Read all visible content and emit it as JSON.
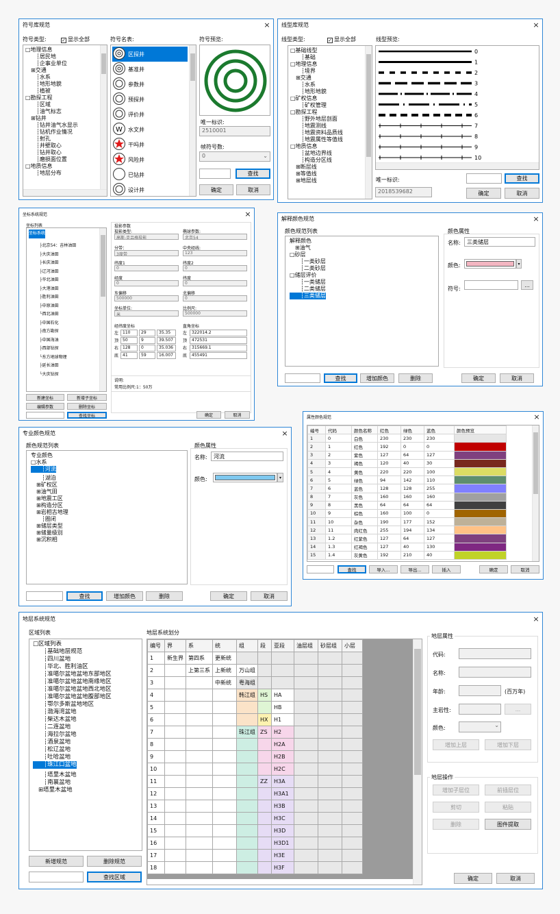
{
  "dlg1": {
    "title": "符号库规范",
    "close": "×",
    "type_label": "符号类型:",
    "show_all": "显示全部",
    "name_label": "符号名表:",
    "preview_label": "符号预览:",
    "tree": [
      "□地理信息",
      "┆居民地",
      "┆企事业单位",
      "⊞交通",
      "┆水系",
      "┆地形地貌",
      "┆植被",
      "□勘探工程",
      "┆区域",
      "┆油气标志",
      "⊞钻井",
      "┆钻井油气水显示",
      "┆钻机作业情况",
      "┆射孔",
      "┆井壁取心",
      "┆钻井取心",
      "┆磨损面位置",
      "□地质信息",
      "┆地层分布"
    ],
    "symbols": [
      "区探井",
      "基准井",
      "参数井",
      "预探井",
      "评价井",
      "水文井",
      "干吗井",
      "风险井",
      "已钻井",
      "设计井"
    ],
    "unique_label": "唯一标识:",
    "unique_value": "2510001",
    "frame_label": "帧符号数:",
    "frame_value": "0",
    "find": "查找",
    "ok": "确定",
    "cancel": "取消"
  },
  "dlg2": {
    "title": "线型库规范",
    "close": "×",
    "type_label": "线型类型:",
    "show_all": "显示全部",
    "preview_label": "线型预览:",
    "tree": [
      "□基础线型",
      "┆基础",
      "□地理信息",
      "┆境界",
      "⊞交通",
      "┆水系",
      "┆地形地貌",
      "□矿权信息",
      "┆矿权管理",
      "□勘探工程",
      "┆野外地层剖面",
      "┆地震测线",
      "┆地震资料品质线",
      "┆地震属性等值线",
      "□地质信息",
      "┆盆地边界线",
      "┆构造分区线",
      "⊞断层线",
      "⊞等值线",
      "⊞地层线"
    ],
    "line_numbers": [
      "0",
      "1",
      "2",
      "3",
      "4",
      "5",
      "6",
      "7",
      "8",
      "9",
      "10"
    ],
    "unique_label": "唯一标识:",
    "unique_value": "2018539682",
    "find": "查找",
    "ok": "确定",
    "cancel": "取消"
  },
  "dlg3": {
    "title": "坐标系统规范",
    "close": "×",
    "list_label": "坐标列表",
    "tree": [
      "坐标系统",
      "├北京54：吉林油田",
      "├大庆油田",
      "├长庆油田",
      "├辽河油田",
      "├华北油田",
      "├大港油田",
      "├胜利油田",
      "├中原油田",
      "└西北油田",
      "├中国石化",
      "├南方勘探",
      "├中国海油",
      "├西部钻探",
      "└东方地球物理",
      "├延长油田",
      "└大庆钻探"
    ],
    "params_title": "投影参数",
    "proj_label": "投影类型:",
    "proj_value": "高斯-克吕格投影",
    "datum_label": "椭球参数:",
    "datum_value": "北京54",
    "zone_label": "分带：",
    "zone_value": "3度带",
    "cm_label": "中央经线:",
    "cm_value": "123",
    "p1_label": "纬度1",
    "p1_value": "0",
    "p2_label": "纬度2",
    "p2_value": "0",
    "lon_label": "经度",
    "lon_value": "0",
    "lat_label": "纬度",
    "lat_value": "0",
    "fe_label": "东偏移",
    "fe_value": "500000",
    "fn_label": "北偏移",
    "fn_value": "0",
    "unit_label": "坐标单位:",
    "unit_value": "米",
    "scale_label": "比例尺:",
    "scale_value": "500000",
    "geo_title": "经纬度坐标",
    "rect_title": "直角坐标",
    "geo_rows": [
      [
        "左",
        "110",
        "29",
        "35.35"
      ],
      [
        "顶",
        "50",
        "9",
        "39.507"
      ],
      [
        "右",
        "128",
        "0",
        "35.036"
      ],
      [
        "底",
        "41",
        "59",
        "16.007"
      ]
    ],
    "rect_rows": [
      [
        "左",
        "322014.2"
      ],
      [
        "顶",
        "472531"
      ],
      [
        "右",
        "315669.1"
      ],
      [
        "底",
        "455491"
      ]
    ],
    "note_label": "说明:",
    "note_value": "常用比例尺:1：50万",
    "btns": [
      "新建坐标",
      "新增子坐标",
      "编辑参数",
      "删除坐标",
      "查找坐标"
    ],
    "ok": "确定",
    "cancel": "取消"
  },
  "dlg4": {
    "title": "解释颜色规范",
    "close": "×",
    "list_label": "颜色规范列表",
    "attr_label": "颜色属性",
    "tree": [
      "解释颜色",
      "⊞油气",
      "□砂层",
      "┆一类砂层",
      "┆二类砂层",
      "□储层评价",
      "┆一类储层",
      "┆二类储层",
      "┆三类储层"
    ],
    "name_label": "名称:",
    "name_value": "三类储层",
    "color_label": "颜色:",
    "symbol_label": "符号:",
    "more": "...",
    "find": "查找",
    "add": "增加颜色",
    "delete": "删除",
    "ok": "确定",
    "cancel": "取消",
    "color_hex": "#f4b6c2"
  },
  "dlg5": {
    "title": "属性颜色规范",
    "close": "×",
    "headers": [
      "编号",
      "代码",
      "颜色名称",
      "红色",
      "绿色",
      "蓝色",
      "颜色预览"
    ],
    "rows": [
      [
        "1",
        "0",
        "白色",
        "230",
        "230",
        "230",
        "#e6e6e6"
      ],
      [
        "2",
        "1",
        "红色",
        "192",
        "0",
        "0",
        "#c00000"
      ],
      [
        "3",
        "2",
        "紫色",
        "127",
        "64",
        "127",
        "#7f407f"
      ],
      [
        "4",
        "3",
        "褐色",
        "120",
        "40",
        "30",
        "#78281e"
      ],
      [
        "5",
        "4",
        "黄色",
        "220",
        "220",
        "100",
        "#dcdc64"
      ],
      [
        "6",
        "5",
        "绿色",
        "94",
        "142",
        "110",
        "#5e8e6e"
      ],
      [
        "7",
        "6",
        "蓝色",
        "128",
        "128",
        "255",
        "#8080ff"
      ],
      [
        "8",
        "7",
        "灰色",
        "160",
        "160",
        "160",
        "#a0a0a0"
      ],
      [
        "9",
        "8",
        "黑色",
        "64",
        "64",
        "64",
        "#404040"
      ],
      [
        "10",
        "9",
        "棕色",
        "160",
        "100",
        "0",
        "#a06400"
      ],
      [
        "11",
        "10",
        "杂色",
        "190",
        "177",
        "152",
        "#beb198"
      ],
      [
        "12",
        "11",
        "肉红色",
        "255",
        "194",
        "134",
        "#ffc286"
      ],
      [
        "13",
        "1.2",
        "红紫色",
        "127",
        "64",
        "127",
        "#7f407f"
      ],
      [
        "14",
        "1.3",
        "红褐色",
        "127",
        "40",
        "130",
        "#7f2882"
      ],
      [
        "15",
        "1.4",
        "灰黄色",
        "192",
        "210",
        "40",
        "#c0d228"
      ]
    ],
    "find": "查找",
    "import": "导入...",
    "export": "导出...",
    "insert": "插入",
    "ok": "确定",
    "cancel": "取消"
  },
  "dlg6": {
    "title": "专业颜色规范",
    "close": "×",
    "list_label": "颜色规范列表",
    "attr_label": "颜色属性",
    "tree": [
      "专业颜色",
      "□水系",
      "┆河流",
      "┆湖泊",
      "⊞矿权区",
      "⊞油气田",
      "⊞地震工区",
      "⊞构造分区",
      "⊞岩相古地理",
      "┆圈闭",
      "⊞储层类型",
      "⊞储量级别",
      "⊞沉积相"
    ],
    "name_label": "名称:",
    "name_value": "河流",
    "color_label": "颜色:",
    "find": "查找",
    "add": "增加颜色",
    "delete": "删除",
    "ok": "确定",
    "cancel": "取消",
    "color_hex": "#7fc8ef"
  },
  "dlg7": {
    "title": "地层系统规范",
    "close": "×",
    "region_label": "区域列表",
    "divide_label": "地层系统划分",
    "tree": [
      "□区域列表",
      "┆基础地层规范",
      "┆四川盆地",
      "┆华北、胜利油区",
      "┆准噶尔盆地盆地东部地区",
      "┆准噶尔盆地盆地南缘地区",
      "┆准噶尔盆地盆地西北地区",
      "┆准噶尔盆地盆地腹部地区",
      "┆鄂尔多斯盆地地区",
      "┆渤海湾盆地",
      "┆柴达木盆地",
      "┆二连盆地",
      "┆海拉尔盆地",
      "┆酒泉盆地",
      "┆松辽盆地",
      "┆吐哈盆地",
      "┆珠江口盆地",
      "┆塔里木盆地",
      "┆南襄盆地",
      "⊞塔里木盆地"
    ],
    "headers": [
      "编号",
      "界",
      "系",
      "统",
      "组",
      "段",
      "亚段",
      "油层组",
      "砂层组",
      "小层"
    ],
    "rows": [
      [
        "1",
        "新生界",
        "第四系",
        "更新统",
        "",
        "",
        "",
        "",
        "",
        ""
      ],
      [
        "2",
        "",
        "上第三系",
        "上新统",
        "万山组",
        "",
        "",
        "",
        "",
        ""
      ],
      [
        "3",
        "",
        "",
        "中新统",
        "粤海组",
        "",
        "",
        "",
        "",
        ""
      ],
      [
        "4",
        "",
        "",
        "",
        "韩江组",
        "HS",
        "HA",
        "",
        "",
        ""
      ],
      [
        "5",
        "",
        "",
        "",
        "",
        "",
        "HB",
        "",
        "",
        ""
      ],
      [
        "6",
        "",
        "",
        "",
        "",
        "HX",
        "H1",
        "",
        "",
        ""
      ],
      [
        "7",
        "",
        "",
        "",
        "珠江组",
        "ZS",
        "H2",
        "",
        "",
        ""
      ],
      [
        "8",
        "",
        "",
        "",
        "",
        "",
        "H2A",
        "",
        "",
        ""
      ],
      [
        "9",
        "",
        "",
        "",
        "",
        "",
        "H2B",
        "",
        "",
        ""
      ],
      [
        "10",
        "",
        "",
        "",
        "",
        "",
        "H2C",
        "",
        "",
        ""
      ],
      [
        "11",
        "",
        "",
        "",
        "",
        "ZZ",
        "H3A",
        "",
        "",
        ""
      ],
      [
        "12",
        "",
        "",
        "",
        "",
        "",
        "H3A1",
        "",
        "",
        ""
      ],
      [
        "13",
        "",
        "",
        "",
        "",
        "",
        "H3B",
        "",
        "",
        ""
      ],
      [
        "14",
        "",
        "",
        "",
        "",
        "",
        "H3C",
        "",
        "",
        ""
      ],
      [
        "15",
        "",
        "",
        "",
        "",
        "",
        "H3D",
        "",
        "",
        ""
      ],
      [
        "16",
        "",
        "",
        "",
        "",
        "",
        "H3D1",
        "",
        "",
        ""
      ],
      [
        "17",
        "",
        "",
        "",
        "",
        "",
        "H3E",
        "",
        "",
        ""
      ],
      [
        "18",
        "",
        "",
        "",
        "",
        "",
        "H3F",
        "",
        "",
        ""
      ]
    ],
    "attr_title": "地层属性",
    "code_label": "代码:",
    "name_label": "名称:",
    "age_label": "年龄:",
    "age_unit": "(百万年)",
    "rock_label": "主岩性:",
    "more": "...",
    "color_label": "颜色:",
    "add_up": "增加上层",
    "add_down": "增加下层",
    "ops_title": "地层操作",
    "add_child": "增加子层位",
    "prev": "前插层位",
    "cut": "剪切",
    "paste": "粘贴",
    "delete": "删除",
    "extract": "图件提取",
    "new_btn": "新增规范",
    "del_btn": "删除规范",
    "find_btn": "查找区域",
    "ok": "确定",
    "cancel": "取消"
  }
}
